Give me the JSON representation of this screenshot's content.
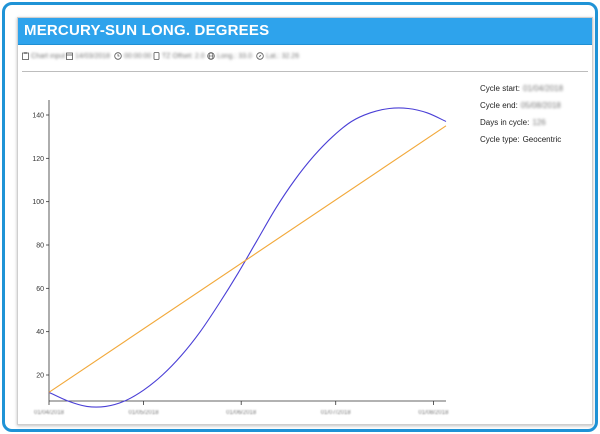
{
  "header": {
    "title": "MERCURY-SUN LONG. DEGREES"
  },
  "toolbar": {
    "chart_input": "Chart input",
    "date": "14/03/2018",
    "time": "00:00:00",
    "tz_offset": "TZ Offset: 2.0",
    "longitude": "Long.: 33.0",
    "latitude": "Lat.: 32.26"
  },
  "info_panel": {
    "cycle_start_label": "Cycle start:",
    "cycle_start_value": "01/04/2018",
    "cycle_end_label": "Cycle end:",
    "cycle_end_value": "05/08/2018",
    "days_label": "Days in cycle:",
    "days_value": "126",
    "type_label": "Cycle type:",
    "type_value": "Geocentric"
  },
  "colors": {
    "title_bar": "#2ea3ec",
    "frame": "#1f93d6",
    "curve": "#4a3fd6",
    "line": "#f2a93b"
  },
  "chart_data": {
    "type": "line",
    "title": "",
    "xlabel": "",
    "ylabel": "",
    "x_range_days": [
      0,
      126
    ],
    "ylim": [
      8,
      146
    ],
    "yticks": [
      20,
      40,
      60,
      80,
      100,
      120,
      140
    ],
    "date_ticks": [
      {
        "day": 0,
        "label": "01/04/2018"
      },
      {
        "day": 30,
        "label": "01/05/2018"
      },
      {
        "day": 61,
        "label": "01/06/2018"
      },
      {
        "day": 91,
        "label": "01/07/2018"
      },
      {
        "day": 122,
        "label": "01/08/2018"
      }
    ],
    "series": [
      {
        "values": [
          [
            0,
            12.0
          ],
          [
            6,
            8.0
          ],
          [
            12,
            5.5
          ],
          [
            18,
            5.5
          ],
          [
            24,
            8.0
          ],
          [
            30,
            13.0
          ],
          [
            36,
            20.0
          ],
          [
            42,
            29.0
          ],
          [
            48,
            40.0
          ],
          [
            54,
            53.0
          ],
          [
            60,
            67.0
          ],
          [
            66,
            82.0
          ],
          [
            72,
            97.0
          ],
          [
            78,
            110.0
          ],
          [
            84,
            121.0
          ],
          [
            90,
            130.0
          ],
          [
            96,
            137.0
          ],
          [
            102,
            141.0
          ],
          [
            108,
            143.0
          ],
          [
            114,
            143.0
          ],
          [
            120,
            141.0
          ],
          [
            126,
            137.0
          ]
        ]
      },
      {
        "values": [
          [
            0,
            12.0
          ],
          [
            126,
            135.0
          ]
        ]
      }
    ],
    "grid": false,
    "legend": "none"
  }
}
